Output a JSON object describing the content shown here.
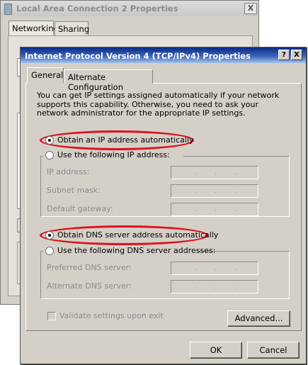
{
  "back_window": {
    "title": "Local Area Connection 2 Properties",
    "close_label": "X",
    "tabs": [
      {
        "label": "Networking",
        "selected": true
      },
      {
        "label": "Sharing",
        "selected": false
      }
    ]
  },
  "dialog": {
    "title": "Internet Protocol Version 4 (TCP/IPv4) Properties",
    "help_label": "?",
    "close_label": "X",
    "tabs": [
      {
        "label": "General",
        "selected": true
      },
      {
        "label": "Alternate Configuration",
        "selected": false
      }
    ],
    "description": "You can get IP settings assigned automatically if your network supports this capability. Otherwise, you need to ask your network administrator for the appropriate IP settings.",
    "ip_section": {
      "auto_option": {
        "label": "Obtain an IP address automatically",
        "selected": true
      },
      "manual_option": {
        "label": "Use the following IP address:",
        "selected": false
      },
      "fields": [
        {
          "label": "IP address:",
          "value": ""
        },
        {
          "label": "Subnet mask:",
          "value": ""
        },
        {
          "label": "Default gateway:",
          "value": ""
        }
      ]
    },
    "dns_section": {
      "auto_option": {
        "label": "Obtain DNS server address automatically",
        "selected": true
      },
      "manual_option": {
        "label": "Use the following DNS server addresses:",
        "selected": false
      },
      "fields": [
        {
          "label": "Preferred DNS server:",
          "value": ""
        },
        {
          "label": "Alternate DNS server:",
          "value": ""
        }
      ]
    },
    "validate_checkbox": {
      "label": "Validate settings upon exit",
      "checked": false,
      "enabled": false
    },
    "advanced_label": "Advanced...",
    "ok_label": "OK",
    "cancel_label": "Cancel"
  },
  "colors": {
    "highlight": "#e0101b",
    "title_bar_active": "#0a2a86",
    "window_face": "#d4d0c8"
  }
}
